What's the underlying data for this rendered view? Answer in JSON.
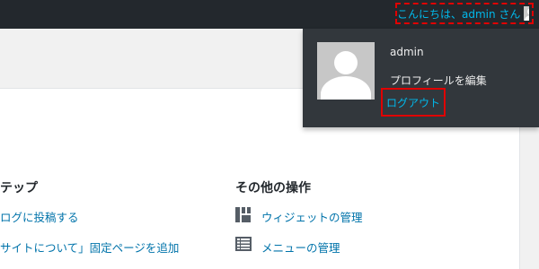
{
  "adminbar": {
    "greeting": "こんにちは、admin さん",
    "avatar_icon": "user-avatar-icon"
  },
  "dropdown": {
    "username": "admin",
    "edit_profile": "プロフィールを編集",
    "logout": "ログアウト"
  },
  "next_steps": {
    "heading": "テップ",
    "links": [
      "ログに投稿する",
      "サイトについて」固定ページを追加"
    ]
  },
  "more_actions": {
    "heading": "その他の操作",
    "links": [
      {
        "label": "ウィジェットの管理",
        "icon": "widgets-icon"
      },
      {
        "label": "メニューの管理",
        "icon": "menus-icon"
      }
    ]
  },
  "colors": {
    "adminbar_bg": "#23282d",
    "dropdown_bg": "#32373c",
    "link_blue": "#0073aa",
    "adminbar_link": "#00b9eb",
    "highlight_red": "#e00000"
  }
}
